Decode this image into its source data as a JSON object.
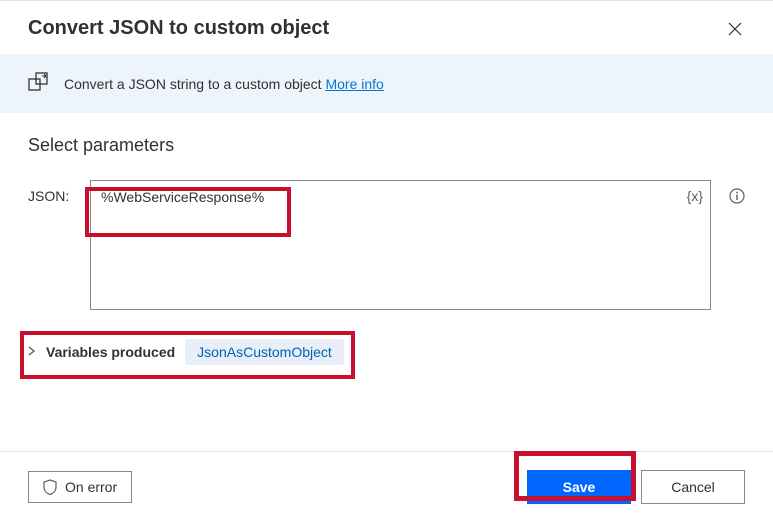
{
  "header": {
    "title": "Convert JSON to custom object"
  },
  "banner": {
    "text": "Convert a JSON string to a custom object ",
    "more_info": "More info"
  },
  "params": {
    "section_title": "Select parameters",
    "json_label": "JSON:",
    "json_value": "%WebServiceResponse%",
    "var_icon": "{x}"
  },
  "variables": {
    "label": "Variables produced",
    "chip": "JsonAsCustomObject"
  },
  "footer": {
    "on_error": "On error",
    "save": "Save",
    "cancel": "Cancel"
  }
}
